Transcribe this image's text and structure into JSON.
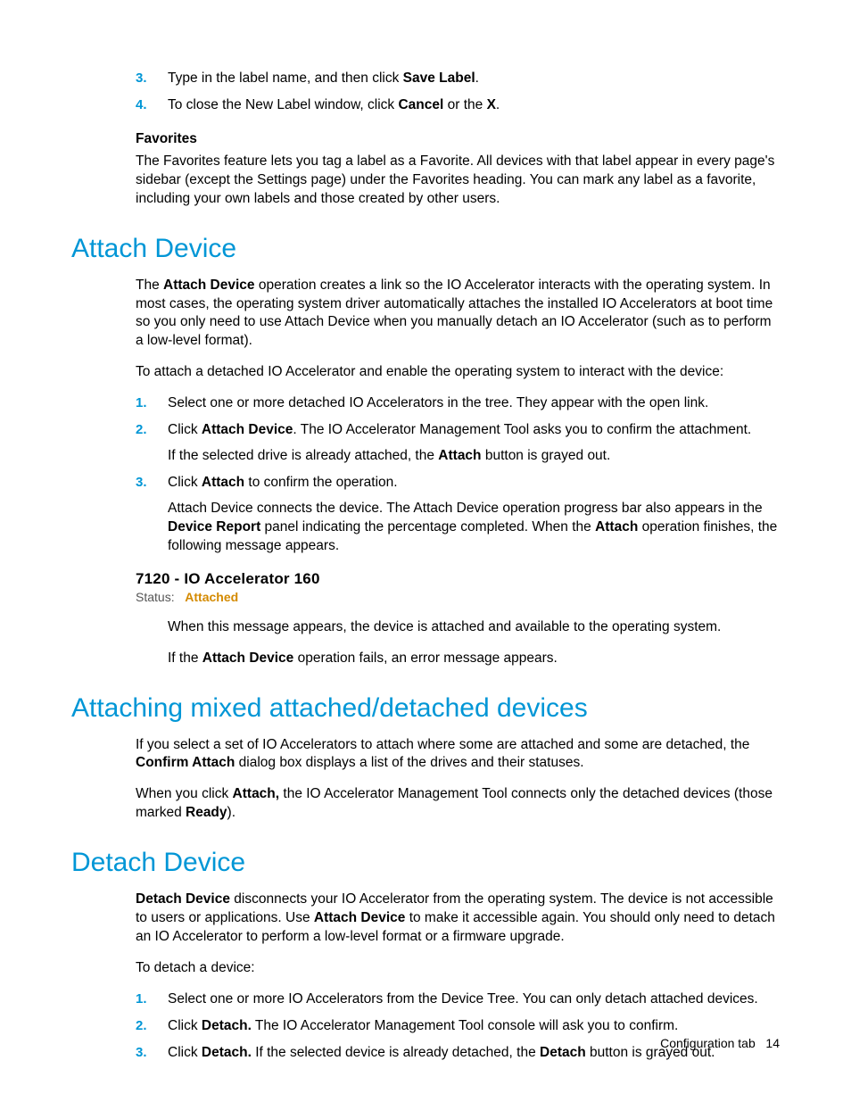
{
  "intro_list": [
    {
      "num": "3.",
      "pre": "Type in the label name, and then click ",
      "b1": "Save Label",
      "post": "."
    },
    {
      "num": "4.",
      "pre": "To close the New Label window, click ",
      "b1": "Cancel",
      "mid": " or the ",
      "b2": "X",
      "post": "."
    }
  ],
  "favorites": {
    "heading": "Favorites",
    "text": "The Favorites feature lets you tag a label as a Favorite. All devices with that label appear in every page's sidebar (except the Settings page) under the Favorites heading. You can mark any label as a favorite, including your own labels and those created by other users."
  },
  "attach": {
    "heading": "Attach Device",
    "p1_pre": "The ",
    "p1_b": "Attach Device",
    "p1_post": " operation creates a link so the IO Accelerator interacts with the operating system. In most cases, the operating system driver automatically attaches the installed IO Accelerators at boot time so you only need to use Attach Device when you manually detach an IO Accelerator (such as to perform a low-level format).",
    "p2": "To attach a detached IO Accelerator and enable the operating system to interact with the device:",
    "steps": {
      "s1": "Select one or more detached IO Accelerators in the tree. They appear with the open link.",
      "s2_pre": "Click ",
      "s2_b": "Attach Device",
      "s2_post": ". The IO Accelerator Management Tool asks you to confirm the attachment.",
      "s2_f_pre": "If the selected drive is already attached, the ",
      "s2_f_b": "Attach",
      "s2_f_post": " button is grayed out.",
      "s3_pre": "Click ",
      "s3_b": "Attach",
      "s3_post": " to confirm the operation.",
      "s3_f_pre": "Attach Device connects the device. The Attach Device operation progress bar also appears in the ",
      "s3_f_b1": "Device Report",
      "s3_f_mid": " panel indicating the percentage completed. When the ",
      "s3_f_b2": "Attach",
      "s3_f_post": " operation finishes, the following message appears."
    },
    "status": {
      "title": "7120 - IO Accelerator 160",
      "label": "Status:",
      "value": "Attached"
    },
    "after1": "When this message appears, the device is attached and available to the operating system.",
    "after2_pre": "If the ",
    "after2_b": "Attach Device",
    "after2_post": " operation fails, an error message appears."
  },
  "mixed": {
    "heading": "Attaching mixed attached/detached devices",
    "p1_pre": "If you select a set of IO Accelerators to attach where some are attached and some are detached, the ",
    "p1_b": "Confirm Attach",
    "p1_post": " dialog box displays a list of the drives and their statuses.",
    "p2_pre": "When you click ",
    "p2_b1": "Attach,",
    "p2_mid": " the IO Accelerator Management Tool connects only the detached devices (those marked ",
    "p2_b2": "Ready",
    "p2_post": ")."
  },
  "detach": {
    "heading": "Detach Device",
    "p1_b1": "Detach Device",
    "p1_mid1": " disconnects your IO Accelerator from the operating system. The device is not accessible to users or applications. Use ",
    "p1_b2": "Attach Device",
    "p1_post": " to make it accessible again. You should only need to detach an IO Accelerator to perform a low-level format or a firmware upgrade.",
    "p2": "To detach a device:",
    "steps": {
      "s1": "Select one or more IO Accelerators from the Device Tree. You can only detach attached devices.",
      "s2_pre": "Click ",
      "s2_b": "Detach.",
      "s2_post": " The IO Accelerator Management Tool console will ask you to confirm.",
      "s3_pre": "Click ",
      "s3_b1": "Detach.",
      "s3_mid": " If the selected device is already detached, the ",
      "s3_b2": "Detach",
      "s3_post": " button is grayed out."
    }
  },
  "footer": {
    "section": "Configuration tab",
    "page": "14"
  }
}
